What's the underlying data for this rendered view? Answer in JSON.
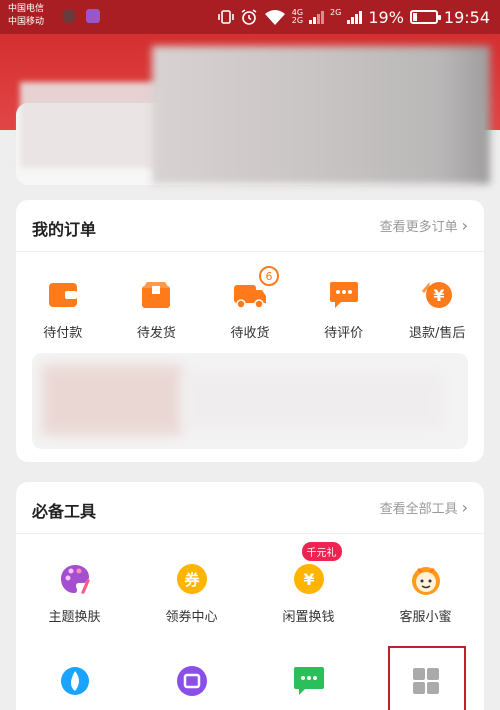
{
  "status_bar": {
    "carrier1": "中国电信",
    "carrier2": "中国移动",
    "network_top": "4G",
    "network_bottom": "2G",
    "network_second": "2G",
    "battery_text": "19%",
    "battery_level": 0.19,
    "time": "19:54"
  },
  "orders": {
    "title": "我的订单",
    "more": "查看更多订单",
    "items": [
      {
        "label": "待付款",
        "icon": "wallet-icon"
      },
      {
        "label": "待发货",
        "icon": "package-icon"
      },
      {
        "label": "待收货",
        "icon": "truck-icon",
        "badge": "6"
      },
      {
        "label": "待评价",
        "icon": "comment-icon"
      },
      {
        "label": "退款/售后",
        "icon": "refund-icon"
      }
    ]
  },
  "tools": {
    "title": "必备工具",
    "more": "查看全部工具",
    "items": [
      {
        "label": "主题换肤",
        "icon": "palette-icon"
      },
      {
        "label": "领券中心",
        "icon": "coupon-icon"
      },
      {
        "label": "闲置换钱",
        "icon": "money-icon",
        "tag": "千元礼"
      },
      {
        "label": "客服小蜜",
        "icon": "service-icon"
      }
    ],
    "row2_icons": [
      "drop-icon",
      "swap-icon",
      "chat-icon",
      "grid-icon"
    ],
    "coupon_glyph": "券",
    "money_glyph": "¥",
    "refund_glyph": "¥"
  },
  "colors": {
    "brand_red": "#d52f30",
    "status_bar": "#a81e22",
    "orange": "#ff7a1a",
    "tag_pink": "#ee2452"
  }
}
